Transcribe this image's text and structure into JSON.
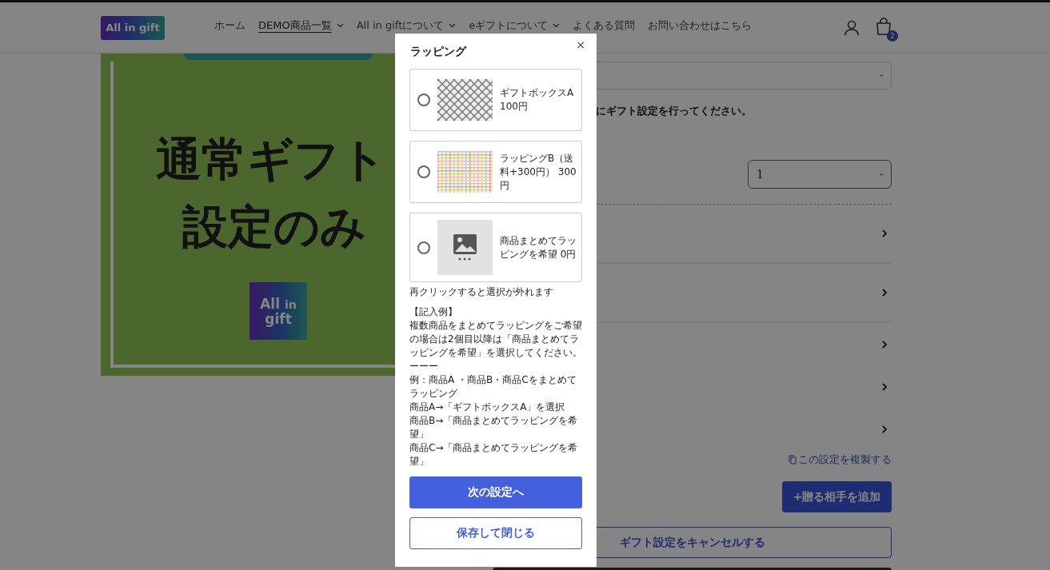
{
  "header": {
    "logo": "All in gift",
    "nav": [
      {
        "label": "ホーム",
        "dropdown": false,
        "selected": false
      },
      {
        "label": "DEMO商品一覧",
        "dropdown": true,
        "selected": true
      },
      {
        "label": "All in giftについて",
        "dropdown": true,
        "selected": false
      },
      {
        "label": "eギフトについて",
        "dropdown": true,
        "selected": false
      },
      {
        "label": "よくある質問",
        "dropdown": false,
        "selected": false
      },
      {
        "label": "お問い合わせはこちら",
        "dropdown": false,
        "selected": false
      }
    ],
    "cart_count": "2"
  },
  "product_image": {
    "lines": [
      "通常ギフト",
      "設定のみ"
    ],
    "logo_lines": [
      "All",
      "in",
      "gift"
    ]
  },
  "gift_form": {
    "instruction": "にギフト設定を行ってください。",
    "quantity": "1",
    "sections": [
      {
        "expanded": false
      },
      {
        "expanded": false
      },
      {
        "expanded": false
      },
      {
        "expanded": false
      },
      {
        "expanded": false
      }
    ],
    "copy_link": "この設定を複製する",
    "add_button": "+贈る相手を追加",
    "cancel_button": "ギフト設定をキャンセルする"
  },
  "modal": {
    "title": "ラッピング",
    "close": "×",
    "options": [
      {
        "kind": "lattice",
        "label": "ギフトボックスA 100円",
        "selected": false
      },
      {
        "kind": "plaid",
        "label": "ラッピングB（送料+300円） 300円",
        "selected": false
      },
      {
        "kind": "placeholder",
        "label": "商品まとめてラッピングを希望 0円",
        "selected": false
      }
    ],
    "note": "再クリックすると選択が外れます",
    "example": [
      "【記入例】",
      "複数商品をまとめてラッピングをご希望の場合は2個目以降は「商品まとめてラッピングを希望」を選択してください。",
      "ーーー",
      "例：商品A ・商品B・商品Cをまとめてラッピング",
      "商品A→「ギフトボックスA」を選択",
      "商品B→「商品まとめてラッピングを希望」",
      "商品C→「商品まとめてラッピングを希望」"
    ],
    "next_button": "次の設定へ",
    "save_button": "保存して閉じる"
  }
}
